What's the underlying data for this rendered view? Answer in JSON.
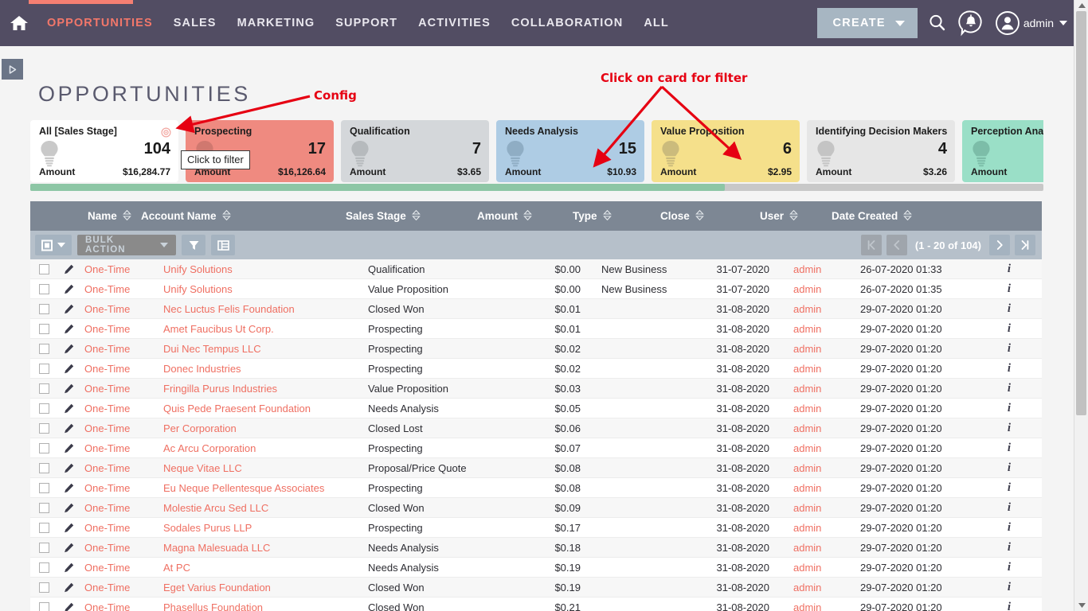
{
  "nav": {
    "home_icon": "home-icon",
    "items": [
      {
        "label": "OPPORTUNITIES",
        "active": true
      },
      {
        "label": "SALES",
        "active": false
      },
      {
        "label": "MARKETING",
        "active": false
      },
      {
        "label": "SUPPORT",
        "active": false
      },
      {
        "label": "ACTIVITIES",
        "active": false
      },
      {
        "label": "COLLABORATION",
        "active": false
      },
      {
        "label": "ALL",
        "active": false
      }
    ],
    "create_label": "CREATE",
    "search_icon": "search-icon",
    "notifications_icon": "notification-bell-icon",
    "user_icon": "user-avatar-icon",
    "user_label": "admin",
    "accent_color": "#f57f72",
    "bar_color": "#524d63"
  },
  "page": {
    "title": "OPPORTUNITIES",
    "expander_icon": "sidebar-expand-icon"
  },
  "annotations": [
    {
      "id": "config",
      "text": "Config",
      "color": "#e60012"
    },
    {
      "id": "click-card",
      "text": "Click on card for filter",
      "color": "#e60012"
    }
  ],
  "tooltip": {
    "text": "Click to filter"
  },
  "cards": {
    "amount_label": "Amount",
    "config_icon": "config-gear-icon",
    "items": [
      {
        "title": "All [Sales Stage]",
        "count": "104",
        "amount": "$16,284.77",
        "bg": "#ffffff",
        "bulb": "#c9c9c9",
        "has_config": true
      },
      {
        "title": "Prospecting",
        "count": "17",
        "amount": "$16,126.64",
        "bg": "#ef8a80",
        "bulb": "#d0786f",
        "has_config": false
      },
      {
        "title": "Qualification",
        "count": "7",
        "amount": "$3.65",
        "bg": "#d4d7da",
        "bulb": "#b6babd",
        "has_config": false
      },
      {
        "title": "Needs Analysis",
        "count": "15",
        "amount": "$10.93",
        "bg": "#aecce4",
        "bulb": "#8fadc4",
        "has_config": false
      },
      {
        "title": "Value Proposition",
        "count": "6",
        "amount": "$2.95",
        "bg": "#f5e08b",
        "bulb": "#cbbb7c",
        "has_config": false
      },
      {
        "title": "Identifying Decision Makers",
        "count": "4",
        "amount": "$3.26",
        "bg": "#e6e6e6",
        "bulb": "#c4c4c4",
        "has_config": false
      },
      {
        "title": "Perception Analysis",
        "count": "",
        "amount": "",
        "bg": "#9adfc7",
        "bulb": "#7cbda8",
        "has_config": false
      }
    ]
  },
  "table": {
    "columns": [
      {
        "label": "Name"
      },
      {
        "label": "Account Name"
      },
      {
        "label": "Sales Stage"
      },
      {
        "label": "Amount"
      },
      {
        "label": "Type"
      },
      {
        "label": "Close"
      },
      {
        "label": "User"
      },
      {
        "label": "Date Created"
      }
    ],
    "toolbar": {
      "select_icon": "select-all-checkbox-icon",
      "bulk_action_label": "BULK ACTION",
      "filter_icon": "funnel-filter-icon",
      "columns_icon": "column-chooser-icon"
    },
    "pager": {
      "first_icon": "first-page-icon",
      "prev_icon": "previous-page-icon",
      "info": "(1 - 20 of 104)",
      "next_icon": "next-page-icon",
      "last_icon": "last-page-icon"
    },
    "rows": [
      {
        "name": "One-Time",
        "account": "Unify Solutions",
        "stage": "Qualification",
        "amount": "$0.00",
        "type": "New Business",
        "close": "31-07-2020",
        "user": "admin",
        "created": "26-07-2020 01:33"
      },
      {
        "name": "One-Time",
        "account": "Unify Solutions",
        "stage": "Value Proposition",
        "amount": "$0.00",
        "type": "New Business",
        "close": "31-07-2020",
        "user": "admin",
        "created": "26-07-2020 01:35"
      },
      {
        "name": "One-Time",
        "account": "Nec Luctus Felis Foundation",
        "stage": "Closed Won",
        "amount": "$0.01",
        "type": "",
        "close": "31-08-2020",
        "user": "admin",
        "created": "29-07-2020 01:20"
      },
      {
        "name": "One-Time",
        "account": "Amet Faucibus Ut Corp.",
        "stage": "Prospecting",
        "amount": "$0.01",
        "type": "",
        "close": "31-08-2020",
        "user": "admin",
        "created": "29-07-2020 01:20"
      },
      {
        "name": "One-Time",
        "account": "Dui Nec Tempus LLC",
        "stage": "Prospecting",
        "amount": "$0.02",
        "type": "",
        "close": "31-08-2020",
        "user": "admin",
        "created": "29-07-2020 01:20"
      },
      {
        "name": "One-Time",
        "account": "Donec Industries",
        "stage": "Prospecting",
        "amount": "$0.02",
        "type": "",
        "close": "31-08-2020",
        "user": "admin",
        "created": "29-07-2020 01:20"
      },
      {
        "name": "One-Time",
        "account": "Fringilla Purus Industries",
        "stage": "Value Proposition",
        "amount": "$0.03",
        "type": "",
        "close": "31-08-2020",
        "user": "admin",
        "created": "29-07-2020 01:20"
      },
      {
        "name": "One-Time",
        "account": "Quis Pede Praesent Foundation",
        "stage": "Needs Analysis",
        "amount": "$0.05",
        "type": "",
        "close": "31-08-2020",
        "user": "admin",
        "created": "29-07-2020 01:20"
      },
      {
        "name": "One-Time",
        "account": "Per Corporation",
        "stage": "Closed Lost",
        "amount": "$0.06",
        "type": "",
        "close": "31-08-2020",
        "user": "admin",
        "created": "29-07-2020 01:20"
      },
      {
        "name": "One-Time",
        "account": "Ac Arcu Corporation",
        "stage": "Prospecting",
        "amount": "$0.07",
        "type": "",
        "close": "31-08-2020",
        "user": "admin",
        "created": "29-07-2020 01:20"
      },
      {
        "name": "One-Time",
        "account": "Neque Vitae LLC",
        "stage": "Proposal/Price Quote",
        "amount": "$0.08",
        "type": "",
        "close": "31-08-2020",
        "user": "admin",
        "created": "29-07-2020 01:20"
      },
      {
        "name": "One-Time",
        "account": "Eu Neque Pellentesque Associates",
        "stage": "Prospecting",
        "amount": "$0.08",
        "type": "",
        "close": "31-08-2020",
        "user": "admin",
        "created": "29-07-2020 01:20"
      },
      {
        "name": "One-Time",
        "account": "Molestie Arcu Sed LLC",
        "stage": "Closed Won",
        "amount": "$0.09",
        "type": "",
        "close": "31-08-2020",
        "user": "admin",
        "created": "29-07-2020 01:20"
      },
      {
        "name": "One-Time",
        "account": "Sodales Purus LLP",
        "stage": "Prospecting",
        "amount": "$0.17",
        "type": "",
        "close": "31-08-2020",
        "user": "admin",
        "created": "29-07-2020 01:20"
      },
      {
        "name": "One-Time",
        "account": "Magna Malesuada LLC",
        "stage": "Needs Analysis",
        "amount": "$0.18",
        "type": "",
        "close": "31-08-2020",
        "user": "admin",
        "created": "29-07-2020 01:20"
      },
      {
        "name": "One-Time",
        "account": "At PC",
        "stage": "Needs Analysis",
        "amount": "$0.19",
        "type": "",
        "close": "31-08-2020",
        "user": "admin",
        "created": "29-07-2020 01:20"
      },
      {
        "name": "One-Time",
        "account": "Eget Varius Foundation",
        "stage": "Closed Won",
        "amount": "$0.19",
        "type": "",
        "close": "31-08-2020",
        "user": "admin",
        "created": "29-07-2020 01:20"
      },
      {
        "name": "One-Time",
        "account": "Phasellus Foundation",
        "stage": "Closed Won",
        "amount": "$0.21",
        "type": "",
        "close": "31-08-2020",
        "user": "admin",
        "created": "29-07-2020 01:20"
      }
    ],
    "row_info_icon": "info-icon",
    "row_edit_icon": "pencil-edit-icon",
    "row_checkbox": "row-select-checkbox"
  }
}
